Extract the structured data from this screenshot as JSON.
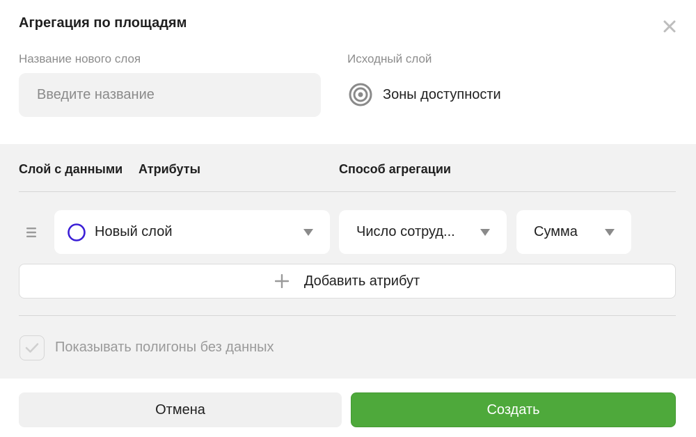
{
  "dialog": {
    "title": "Агрегация по площадям"
  },
  "new_layer": {
    "label": "Название нового слоя",
    "placeholder": "Введите название",
    "value": ""
  },
  "source_layer": {
    "label": "Исходный слой",
    "value": "Зоны доступности",
    "icon": "target-icon"
  },
  "columns": {
    "data_layer": "Слой с данными",
    "attributes": "Атрибуты",
    "aggregation": "Способ агрегации"
  },
  "row": {
    "layer_select": "Новый слой",
    "attribute_select": "Число сотруд...",
    "method_select": "Сумма"
  },
  "add_attribute": {
    "label": "Добавить атрибут"
  },
  "show_empty": {
    "label": "Показывать полигоны без данных",
    "checked": true
  },
  "buttons": {
    "cancel": "Отмена",
    "create": "Создать"
  },
  "colors": {
    "accent_green": "#4ea93b",
    "layer_circle": "#3b1fd6",
    "section_bg": "#f2f2f2"
  }
}
